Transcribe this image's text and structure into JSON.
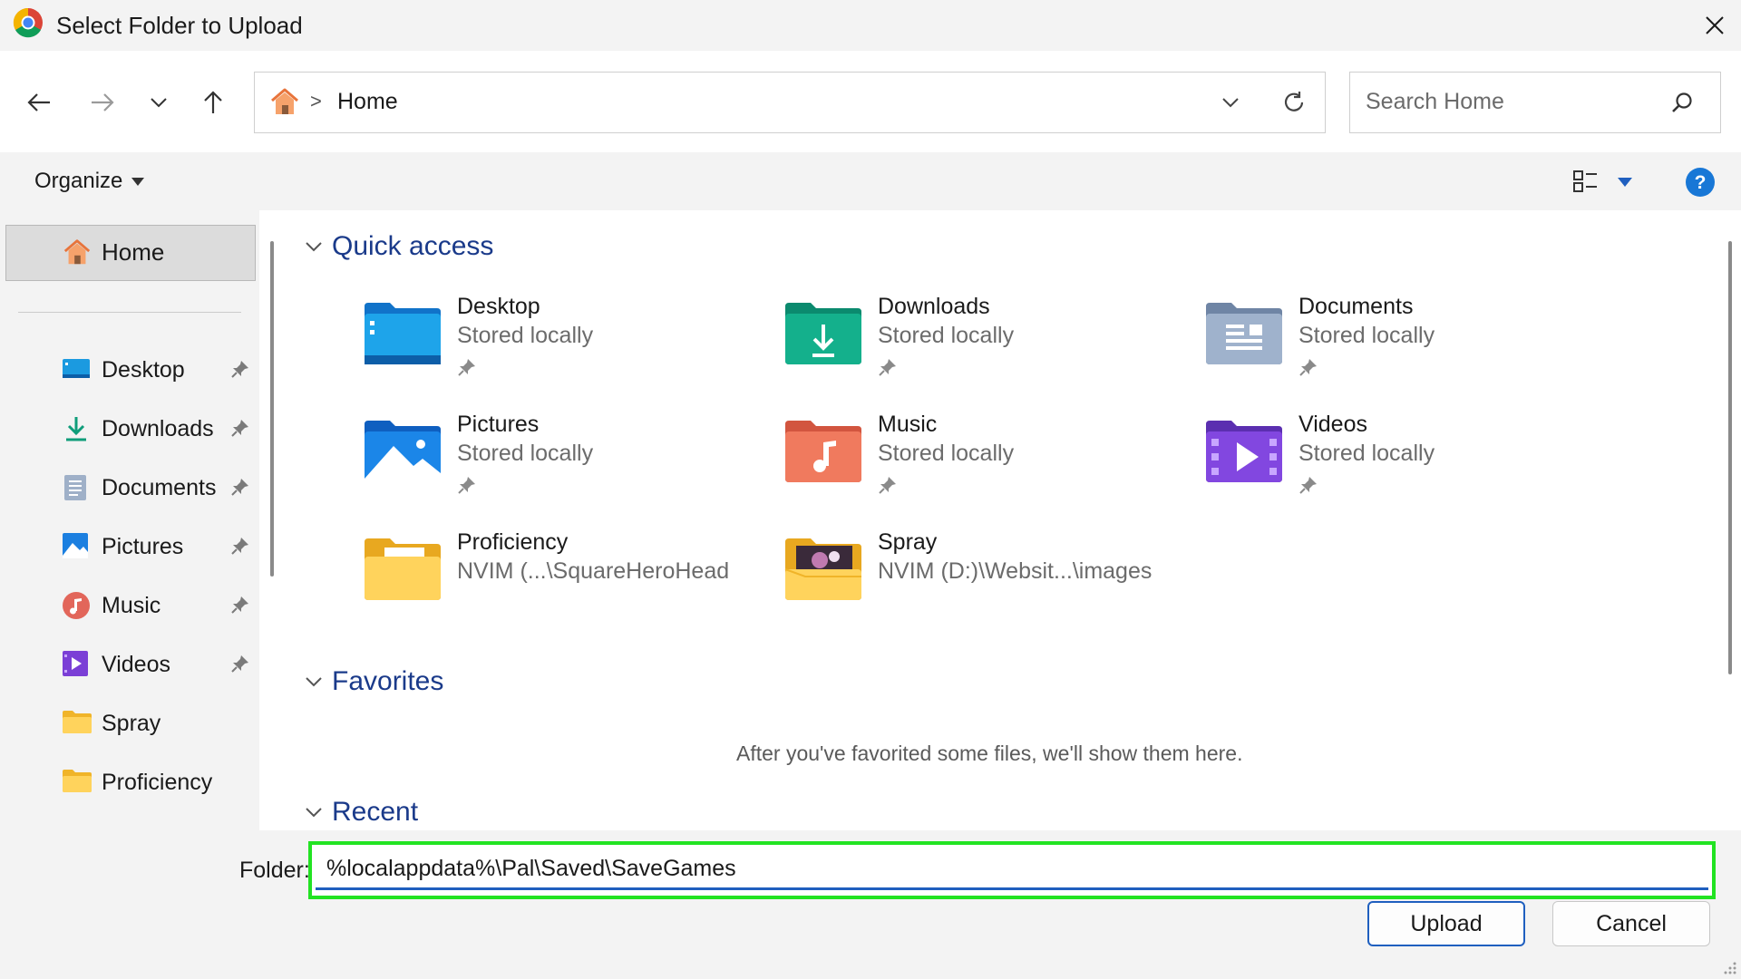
{
  "window": {
    "title": "Select Folder to Upload"
  },
  "address": {
    "location": "Home",
    "separator": ">"
  },
  "search": {
    "placeholder": "Search Home"
  },
  "toolbar": {
    "organize_label": "Organize"
  },
  "sidebar": {
    "home_label": "Home",
    "items": [
      {
        "label": "Desktop",
        "pinned": true,
        "icon": "desktop-icon"
      },
      {
        "label": "Downloads",
        "pinned": true,
        "icon": "downloads-icon"
      },
      {
        "label": "Documents",
        "pinned": true,
        "icon": "documents-icon"
      },
      {
        "label": "Pictures",
        "pinned": true,
        "icon": "pictures-icon"
      },
      {
        "label": "Music",
        "pinned": true,
        "icon": "music-icon"
      },
      {
        "label": "Videos",
        "pinned": true,
        "icon": "videos-icon"
      },
      {
        "label": "Spray",
        "pinned": false,
        "icon": "folder-icon"
      },
      {
        "label": "Proficiency",
        "pinned": false,
        "icon": "folder-icon"
      }
    ]
  },
  "sections": {
    "quick_access": "Quick access",
    "favorites": "Favorites",
    "recent": "Recent",
    "favorites_empty": "After you've favorited some files, we'll show them here."
  },
  "quick_access": [
    {
      "name": "Desktop",
      "sub": "Stored locally",
      "pinned": true,
      "icon": "desktop-folder-icon"
    },
    {
      "name": "Downloads",
      "sub": "Stored locally",
      "pinned": true,
      "icon": "downloads-folder-icon"
    },
    {
      "name": "Documents",
      "sub": "Stored locally",
      "pinned": true,
      "icon": "documents-folder-icon"
    },
    {
      "name": "Pictures",
      "sub": "Stored locally",
      "pinned": true,
      "icon": "pictures-folder-icon"
    },
    {
      "name": "Music",
      "sub": "Stored locally",
      "pinned": true,
      "icon": "music-folder-icon"
    },
    {
      "name": "Videos",
      "sub": "Stored locally",
      "pinned": true,
      "icon": "videos-folder-icon"
    },
    {
      "name": "Proficiency",
      "sub": "NVIM (...\\SquareHeroHead",
      "pinned": false,
      "icon": "folder-icon"
    },
    {
      "name": "Spray",
      "sub": "NVIM (D:)\\Websit...\\images",
      "pinned": false,
      "icon": "image-folder-icon"
    }
  ],
  "folder": {
    "label": "Folder:",
    "value": "%localappdata%\\Pal\\Saved\\SaveGames"
  },
  "buttons": {
    "upload": "Upload",
    "cancel": "Cancel"
  },
  "colors": {
    "accent": "#1f5fbf",
    "focus_outline": "#22e322",
    "section_heading": "#1a3a8a",
    "help": "#1877d6"
  }
}
